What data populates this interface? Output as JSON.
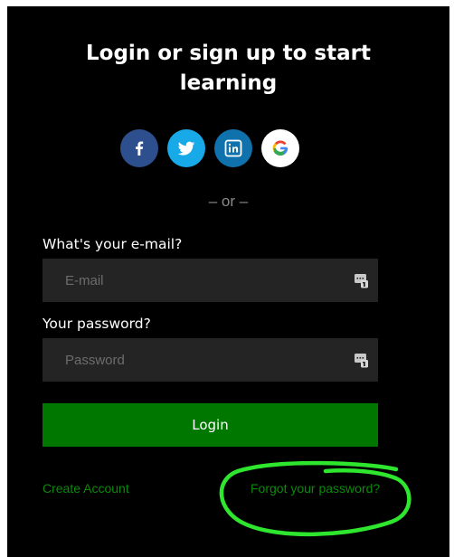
{
  "heading": {
    "line1": "Login or sign up to start",
    "line2": "learning"
  },
  "social": [
    {
      "name": "facebook",
      "icon": "facebook-icon",
      "color": "#2d4f8d"
    },
    {
      "name": "twitter",
      "icon": "twitter-icon",
      "color": "#17a9e8"
    },
    {
      "name": "linkedin",
      "icon": "linkedin-icon",
      "color": "#0f72ad"
    },
    {
      "name": "google",
      "icon": "google-icon",
      "color": "#ffffff"
    }
  ],
  "divider": "– or –",
  "email": {
    "label": "What's your e-mail?",
    "placeholder": "E-mail",
    "value": ""
  },
  "password": {
    "label": "Your password?",
    "placeholder": "Password",
    "value": ""
  },
  "login_button": "Login",
  "links": {
    "create_account": "Create Account",
    "forgot_password": "Forgot your password?"
  },
  "colors": {
    "background": "#000000",
    "field": "#242424",
    "primary": "#007800",
    "link": "#0a8a0a",
    "annotation": "#2ee62e"
  }
}
